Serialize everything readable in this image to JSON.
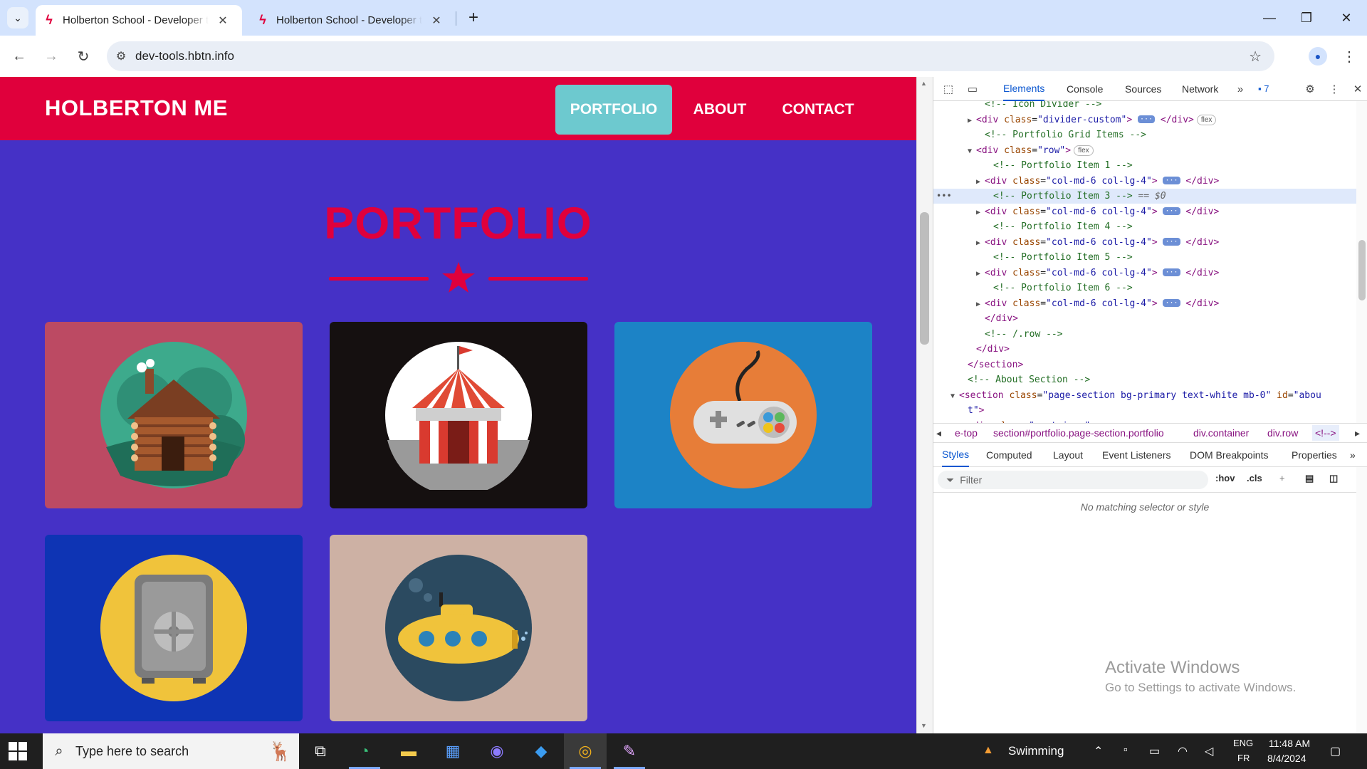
{
  "browser": {
    "tabs": [
      {
        "title": "Holberton School - Developer tools",
        "active": true
      },
      {
        "title": "Holberton School - Developer tools",
        "active": false
      }
    ],
    "url": "dev-tools.hbtn.info"
  },
  "site": {
    "brand": "HOLBERTON ME",
    "nav": [
      "PORTFOLIO",
      "ABOUT",
      "CONTACT"
    ],
    "section_title": "PORTFOLIO",
    "colors": {
      "nav_bg": "#e0003c",
      "page_bg": "#4531c6",
      "accent": "#6dc9cf"
    },
    "cards": [
      {
        "icon": "log-cabin-icon",
        "bg": "#bc4a63"
      },
      {
        "icon": "circus-tent-icon",
        "bg": "#151010"
      },
      {
        "icon": "gamepad-icon",
        "bg": "#1c83c6"
      },
      {
        "icon": "safe-icon",
        "bg": "#0e34b4"
      },
      {
        "icon": "submarine-icon",
        "bg": "#cdb1a4"
      }
    ]
  },
  "devtools": {
    "tabs": [
      "Elements",
      "Console",
      "Sources",
      "Network"
    ],
    "issues_count": "7",
    "dom_lines": [
      {
        "indent": 5,
        "tri": "",
        "html": "<span class='t-com'>&lt;!-- Icon Divider --&gt;</span>"
      },
      {
        "indent": 4,
        "tri": "▶",
        "html": "<span class='t-tag'>&lt;div</span> <span class='t-attr'>class</span>=<span class='t-val'>\"divider-custom\"</span><span class='t-tag'>&gt;</span> <span class='ell'>···</span> <span class='t-tag'>&lt;/div&gt;</span><span class='pill'>flex</span>"
      },
      {
        "indent": 5,
        "tri": "",
        "html": "<span class='t-com'>&lt;!-- Portfolio Grid Items --&gt;</span>"
      },
      {
        "indent": 4,
        "tri": "▼",
        "html": "<span class='t-tag'>&lt;div</span> <span class='t-attr'>class</span>=<span class='t-val'>\"row\"</span><span class='t-tag'>&gt;</span><span class='pill'>flex</span>"
      },
      {
        "indent": 6,
        "tri": "",
        "html": "<span class='t-com'>&lt;!-- Portfolio Item 1 --&gt;</span>"
      },
      {
        "indent": 5,
        "tri": "▶",
        "html": "<span class='t-tag'>&lt;div</span> <span class='t-attr'>class</span>=<span class='t-val'>\"col-md-6 col-lg-4\"</span><span class='t-tag'>&gt;</span> <span class='ell'>···</span> <span class='t-tag'>&lt;/div&gt;</span>"
      },
      {
        "indent": 6,
        "tri": "",
        "selected": true,
        "html": "<span class='t-com'>&lt;!-- Portfolio Item 3 --&gt;</span> <span class='t-eq'>== $0</span>"
      },
      {
        "indent": 5,
        "tri": "▶",
        "html": "<span class='t-tag'>&lt;div</span> <span class='t-attr'>class</span>=<span class='t-val'>\"col-md-6 col-lg-4\"</span><span class='t-tag'>&gt;</span> <span class='ell'>···</span> <span class='t-tag'>&lt;/div&gt;</span>"
      },
      {
        "indent": 6,
        "tri": "",
        "html": "<span class='t-com'>&lt;!-- Portfolio Item 4 --&gt;</span>"
      },
      {
        "indent": 5,
        "tri": "▶",
        "html": "<span class='t-tag'>&lt;div</span> <span class='t-attr'>class</span>=<span class='t-val'>\"col-md-6 col-lg-4\"</span><span class='t-tag'>&gt;</span> <span class='ell'>···</span> <span class='t-tag'>&lt;/div&gt;</span>"
      },
      {
        "indent": 6,
        "tri": "",
        "html": "<span class='t-com'>&lt;!-- Portfolio Item 5 --&gt;</span>"
      },
      {
        "indent": 5,
        "tri": "▶",
        "html": "<span class='t-tag'>&lt;div</span> <span class='t-attr'>class</span>=<span class='t-val'>\"col-md-6 col-lg-4\"</span><span class='t-tag'>&gt;</span> <span class='ell'>···</span> <span class='t-tag'>&lt;/div&gt;</span>"
      },
      {
        "indent": 6,
        "tri": "",
        "html": "<span class='t-com'>&lt;!-- Portfolio Item 6 --&gt;</span>"
      },
      {
        "indent": 5,
        "tri": "▶",
        "html": "<span class='t-tag'>&lt;div</span> <span class='t-attr'>class</span>=<span class='t-val'>\"col-md-6 col-lg-4\"</span><span class='t-tag'>&gt;</span> <span class='ell'>···</span> <span class='t-tag'>&lt;/div&gt;</span>"
      },
      {
        "indent": 5,
        "tri": "",
        "html": "<span class='t-tag'>&lt;/div&gt;</span>"
      },
      {
        "indent": 5,
        "tri": "",
        "html": "<span class='t-com'>&lt;!-- /.row --&gt;</span>"
      },
      {
        "indent": 4,
        "tri": "",
        "html": "<span class='t-tag'>&lt;/div&gt;</span>"
      },
      {
        "indent": 3,
        "tri": "",
        "html": "<span class='t-tag'>&lt;/section&gt;</span>"
      },
      {
        "indent": 3,
        "tri": "",
        "html": "<span class='t-com'>&lt;!-- About Section --&gt;</span>"
      },
      {
        "indent": 2,
        "tri": "▼",
        "html": "<span class='t-tag'>&lt;section</span> <span class='t-attr'>class</span>=<span class='t-val'>\"page-section bg-primary text-white mb-0\"</span> <span class='t-attr'>id</span>=<span class='t-val'>\"abou</span>"
      },
      {
        "indent": 3,
        "tri": "",
        "html": "<span class='t-val'>t\"</span><span class='t-tag'>&gt;</span>"
      },
      {
        "indent": 3,
        "tri": "▼",
        "html": "<span class='t-tag'>&lt;div</span> <span class='t-attr'>class</span>=<span class='t-val'>\"container\"</span><span class='t-tag'>&gt;</span>"
      }
    ],
    "breadcrumbs": [
      "e-top",
      "section#portfolio.page-section.portfolio",
      "div.container",
      "div.row",
      "<!-->"
    ],
    "style_tabs": [
      "Styles",
      "Computed",
      "Layout",
      "Event Listeners",
      "DOM Breakpoints",
      "Properties"
    ],
    "filter_placeholder": "Filter",
    "hov_label": ":hov",
    "cls_label": ".cls",
    "no_match": "No matching selector or style"
  },
  "watermark": {
    "line1": "Activate Windows",
    "line2": "Go to Settings to activate Windows."
  },
  "taskbar": {
    "search_placeholder": "Type here to search",
    "weather": "Swimming",
    "lang_top": "ENG",
    "lang_bottom": "FR",
    "time": "11:48 AM",
    "date": "8/4/2024"
  }
}
